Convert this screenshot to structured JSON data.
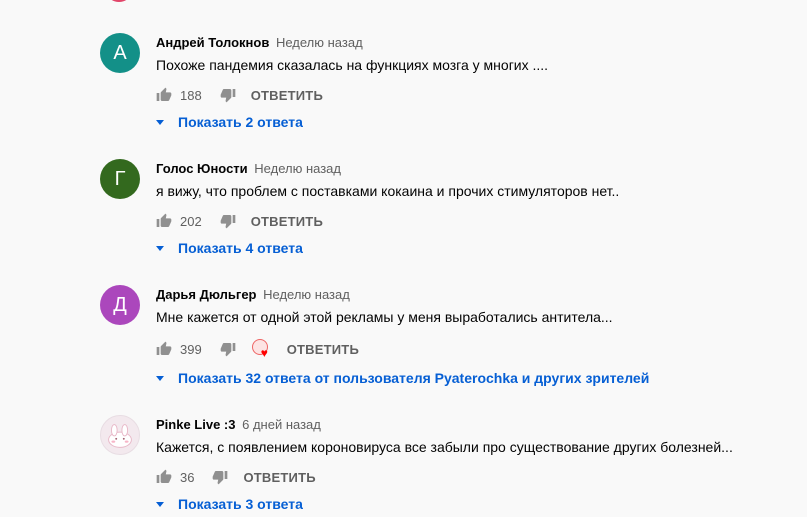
{
  "comments": [
    {
      "avatar_letter": "А",
      "avatar_color": "#139088",
      "author": "Андрей Толокнов",
      "time": "Неделю назад",
      "text": "Похоже пандемия сказалась на функциях мозга у многих ....",
      "likes": "188",
      "reply_label": "ОТВЕТИТЬ",
      "replies_label": "Показать 2 ответа"
    },
    {
      "avatar_letter": "Г",
      "avatar_color": "#33691e",
      "author": "Голос Юности",
      "time": "Неделю назад",
      "text": "я вижу, что проблем с поставками кокаина и прочих стимуляторов нет..",
      "likes": "202",
      "reply_label": "ОТВЕТИТЬ",
      "replies_label": "Показать 4 ответа"
    },
    {
      "avatar_letter": "Д",
      "avatar_color": "#ab47bc",
      "author": "Дарья Дюльгер",
      "time": "Неделю назад",
      "text": "Мне кажется от одной этой рекламы у меня выработались антитела...",
      "likes": "399",
      "reply_label": "ОТВЕТИТЬ",
      "replies_label": "Показать 32 ответа от пользователя Pyaterochka и других зрителей"
    },
    {
      "avatar_letter": "",
      "avatar_color": "#f3e9ee",
      "author": "Pinke Live :3",
      "time": "6 дней назад",
      "text": "Кажется, с появлением короновируса все забыли про существование других болезней...",
      "likes": "36",
      "reply_label": "ОТВЕТИТЬ",
      "replies_label": "Показать 3 ответа"
    }
  ]
}
